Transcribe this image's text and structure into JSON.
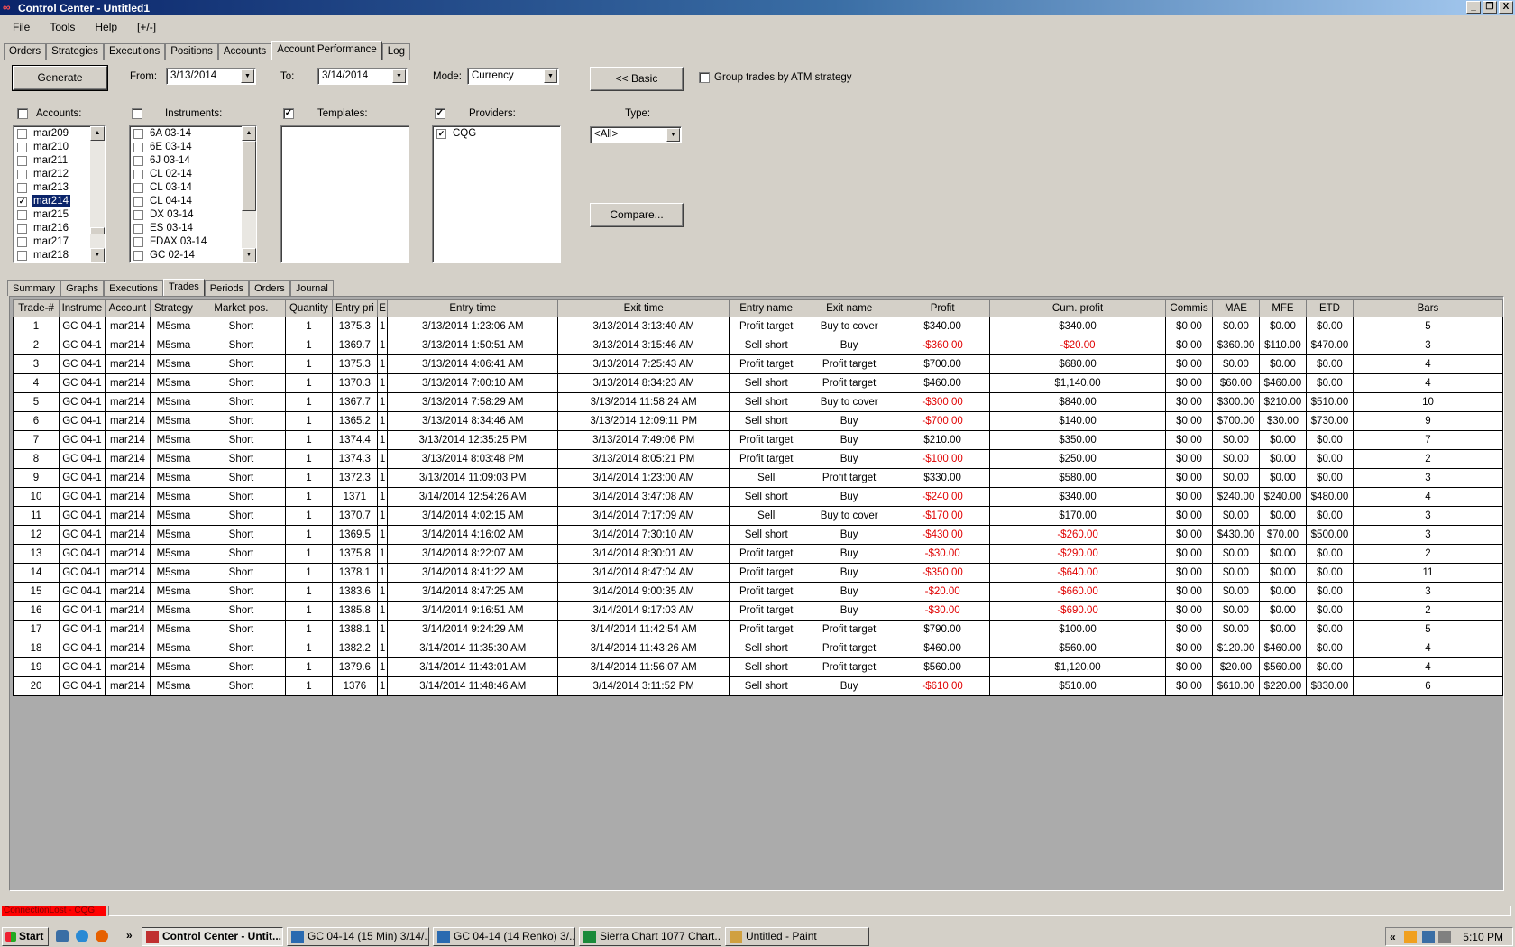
{
  "window": {
    "title": "Control Center - Untitled1",
    "buttons": [
      "_",
      "❒",
      "X"
    ]
  },
  "menu": [
    "File",
    "Tools",
    "Help",
    "[+/-]"
  ],
  "top_tabs": [
    {
      "label": "Orders",
      "active": false
    },
    {
      "label": "Strategies",
      "active": false
    },
    {
      "label": "Executions",
      "active": false
    },
    {
      "label": "Positions",
      "active": false
    },
    {
      "label": "Accounts",
      "active": false
    },
    {
      "label": "Account Performance",
      "active": true
    },
    {
      "label": "Log",
      "active": false
    }
  ],
  "controls": {
    "generate": "Generate",
    "from_label": "From:",
    "from_value": "3/13/2014",
    "to_label": "To:",
    "to_value": "3/14/2014",
    "mode_label": "Mode:",
    "mode_value": "Currency",
    "basic": "<< Basic",
    "group_label": "Group trades by ATM strategy",
    "group_checked": false,
    "type_label": "Type:",
    "type_value": "<All>",
    "compare": "Compare..."
  },
  "accounts": {
    "label": "Accounts:",
    "checked": false,
    "items": [
      {
        "name": "mar209",
        "checked": false,
        "selected": false
      },
      {
        "name": "mar210",
        "checked": false,
        "selected": false
      },
      {
        "name": "mar211",
        "checked": false,
        "selected": false
      },
      {
        "name": "mar212",
        "checked": false,
        "selected": false
      },
      {
        "name": "mar213",
        "checked": false,
        "selected": false
      },
      {
        "name": "mar214",
        "checked": true,
        "selected": true
      },
      {
        "name": "mar215",
        "checked": false,
        "selected": false
      },
      {
        "name": "mar216",
        "checked": false,
        "selected": false
      },
      {
        "name": "mar217",
        "checked": false,
        "selected": false
      },
      {
        "name": "mar218",
        "checked": false,
        "selected": false
      }
    ]
  },
  "instruments": {
    "label": "Instruments:",
    "checked": false,
    "items": [
      {
        "name": "6A 03-14",
        "checked": false
      },
      {
        "name": "6E 03-14",
        "checked": false
      },
      {
        "name": "6J 03-14",
        "checked": false
      },
      {
        "name": "CL 02-14",
        "checked": false
      },
      {
        "name": "CL 03-14",
        "checked": false
      },
      {
        "name": "CL 04-14",
        "checked": false
      },
      {
        "name": "DX 03-14",
        "checked": false
      },
      {
        "name": "ES 03-14",
        "checked": false
      },
      {
        "name": "FDAX 03-14",
        "checked": false
      },
      {
        "name": "GC 02-14",
        "checked": false
      }
    ]
  },
  "templates": {
    "label": "Templates:",
    "checked": true,
    "items": []
  },
  "providers": {
    "label": "Providers:",
    "checked": true,
    "items": [
      {
        "name": "CQG",
        "checked": true
      }
    ]
  },
  "sub_tabs": [
    {
      "label": "Summary",
      "active": false
    },
    {
      "label": "Graphs",
      "active": false
    },
    {
      "label": "Executions",
      "active": false
    },
    {
      "label": "Trades",
      "active": true
    },
    {
      "label": "Periods",
      "active": false
    },
    {
      "label": "Orders",
      "active": false
    },
    {
      "label": "Journal",
      "active": false
    }
  ],
  "trades": {
    "columns": [
      "Trade-#",
      "Instrume",
      "Account",
      "Strategy",
      "Market pos.",
      "Quantity",
      "Entry pri",
      "E",
      "Entry time",
      "Exit time",
      "Entry name",
      "Exit name",
      "Profit",
      "Cum. profit",
      "Commis",
      "MAE",
      "MFE",
      "ETD",
      "Bars"
    ],
    "negative_color": "#e00000",
    "rows": [
      [
        "1",
        "GC 04-1",
        "mar214",
        "M5sma",
        "Short",
        "1",
        "1375.3",
        "1",
        "3/13/2014 1:23:06 AM",
        "3/13/2014 3:13:40 AM",
        "Profit target",
        "Buy to cover",
        "$340.00",
        "$340.00",
        "$0.00",
        "$0.00",
        "$0.00",
        "$0.00",
        "5"
      ],
      [
        "2",
        "GC 04-1",
        "mar214",
        "M5sma",
        "Short",
        "1",
        "1369.7",
        "1",
        "3/13/2014 1:50:51 AM",
        "3/13/2014 3:15:46 AM",
        "Sell short",
        "Buy",
        "-$360.00",
        "-$20.00",
        "$0.00",
        "$360.00",
        "$110.00",
        "$470.00",
        "3"
      ],
      [
        "3",
        "GC 04-1",
        "mar214",
        "M5sma",
        "Short",
        "1",
        "1375.3",
        "1",
        "3/13/2014 4:06:41 AM",
        "3/13/2014 7:25:43 AM",
        "Profit target",
        "Profit target",
        "$700.00",
        "$680.00",
        "$0.00",
        "$0.00",
        "$0.00",
        "$0.00",
        "4"
      ],
      [
        "4",
        "GC 04-1",
        "mar214",
        "M5sma",
        "Short",
        "1",
        "1370.3",
        "1",
        "3/13/2014 7:00:10 AM",
        "3/13/2014 8:34:23 AM",
        "Sell short",
        "Profit target",
        "$460.00",
        "$1,140.00",
        "$0.00",
        "$60.00",
        "$460.00",
        "$0.00",
        "4"
      ],
      [
        "5",
        "GC 04-1",
        "mar214",
        "M5sma",
        "Short",
        "1",
        "1367.7",
        "1",
        "3/13/2014 7:58:29 AM",
        "3/13/2014 11:58:24 AM",
        "Sell short",
        "Buy to cover",
        "-$300.00",
        "$840.00",
        "$0.00",
        "$300.00",
        "$210.00",
        "$510.00",
        "10"
      ],
      [
        "6",
        "GC 04-1",
        "mar214",
        "M5sma",
        "Short",
        "1",
        "1365.2",
        "1",
        "3/13/2014 8:34:46 AM",
        "3/13/2014 12:09:11 PM",
        "Sell short",
        "Buy",
        "-$700.00",
        "$140.00",
        "$0.00",
        "$700.00",
        "$30.00",
        "$730.00",
        "9"
      ],
      [
        "7",
        "GC 04-1",
        "mar214",
        "M5sma",
        "Short",
        "1",
        "1374.4",
        "1",
        "3/13/2014 12:35:25 PM",
        "3/13/2014 7:49:06 PM",
        "Profit target",
        "Buy",
        "$210.00",
        "$350.00",
        "$0.00",
        "$0.00",
        "$0.00",
        "$0.00",
        "7"
      ],
      [
        "8",
        "GC 04-1",
        "mar214",
        "M5sma",
        "Short",
        "1",
        "1374.3",
        "1",
        "3/13/2014 8:03:48 PM",
        "3/13/2014 8:05:21 PM",
        "Profit target",
        "Buy",
        "-$100.00",
        "$250.00",
        "$0.00",
        "$0.00",
        "$0.00",
        "$0.00",
        "2"
      ],
      [
        "9",
        "GC 04-1",
        "mar214",
        "M5sma",
        "Short",
        "1",
        "1372.3",
        "1",
        "3/13/2014 11:09:03 PM",
        "3/14/2014 1:23:00 AM",
        "Sell",
        "Profit target",
        "$330.00",
        "$580.00",
        "$0.00",
        "$0.00",
        "$0.00",
        "$0.00",
        "3"
      ],
      [
        "10",
        "GC 04-1",
        "mar214",
        "M5sma",
        "Short",
        "1",
        "1371",
        "1",
        "3/14/2014 12:54:26 AM",
        "3/14/2014 3:47:08 AM",
        "Sell short",
        "Buy",
        "-$240.00",
        "$340.00",
        "$0.00",
        "$240.00",
        "$240.00",
        "$480.00",
        "4"
      ],
      [
        "11",
        "GC 04-1",
        "mar214",
        "M5sma",
        "Short",
        "1",
        "1370.7",
        "1",
        "3/14/2014 4:02:15 AM",
        "3/14/2014 7:17:09 AM",
        "Sell",
        "Buy to cover",
        "-$170.00",
        "$170.00",
        "$0.00",
        "$0.00",
        "$0.00",
        "$0.00",
        "3"
      ],
      [
        "12",
        "GC 04-1",
        "mar214",
        "M5sma",
        "Short",
        "1",
        "1369.5",
        "1",
        "3/14/2014 4:16:02 AM",
        "3/14/2014 7:30:10 AM",
        "Sell short",
        "Buy",
        "-$430.00",
        "-$260.00",
        "$0.00",
        "$430.00",
        "$70.00",
        "$500.00",
        "3"
      ],
      [
        "13",
        "GC 04-1",
        "mar214",
        "M5sma",
        "Short",
        "1",
        "1375.8",
        "1",
        "3/14/2014 8:22:07 AM",
        "3/14/2014 8:30:01 AM",
        "Profit target",
        "Buy",
        "-$30.00",
        "-$290.00",
        "$0.00",
        "$0.00",
        "$0.00",
        "$0.00",
        "2"
      ],
      [
        "14",
        "GC 04-1",
        "mar214",
        "M5sma",
        "Short",
        "1",
        "1378.1",
        "1",
        "3/14/2014 8:41:22 AM",
        "3/14/2014 8:47:04 AM",
        "Profit target",
        "Buy",
        "-$350.00",
        "-$640.00",
        "$0.00",
        "$0.00",
        "$0.00",
        "$0.00",
        "11"
      ],
      [
        "15",
        "GC 04-1",
        "mar214",
        "M5sma",
        "Short",
        "1",
        "1383.6",
        "1",
        "3/14/2014 8:47:25 AM",
        "3/14/2014 9:00:35 AM",
        "Profit target",
        "Buy",
        "-$20.00",
        "-$660.00",
        "$0.00",
        "$0.00",
        "$0.00",
        "$0.00",
        "3"
      ],
      [
        "16",
        "GC 04-1",
        "mar214",
        "M5sma",
        "Short",
        "1",
        "1385.8",
        "1",
        "3/14/2014 9:16:51 AM",
        "3/14/2014 9:17:03 AM",
        "Profit target",
        "Buy",
        "-$30.00",
        "-$690.00",
        "$0.00",
        "$0.00",
        "$0.00",
        "$0.00",
        "2"
      ],
      [
        "17",
        "GC 04-1",
        "mar214",
        "M5sma",
        "Short",
        "1",
        "1388.1",
        "1",
        "3/14/2014 9:24:29 AM",
        "3/14/2014 11:42:54 AM",
        "Profit target",
        "Profit target",
        "$790.00",
        "$100.00",
        "$0.00",
        "$0.00",
        "$0.00",
        "$0.00",
        "5"
      ],
      [
        "18",
        "GC 04-1",
        "mar214",
        "M5sma",
        "Short",
        "1",
        "1382.2",
        "1",
        "3/14/2014 11:35:30 AM",
        "3/14/2014 11:43:26 AM",
        "Sell short",
        "Profit target",
        "$460.00",
        "$560.00",
        "$0.00",
        "$120.00",
        "$460.00",
        "$0.00",
        "4"
      ],
      [
        "19",
        "GC 04-1",
        "mar214",
        "M5sma",
        "Short",
        "1",
        "1379.6",
        "1",
        "3/14/2014 11:43:01 AM",
        "3/14/2014 11:56:07 AM",
        "Sell short",
        "Profit target",
        "$560.00",
        "$1,120.00",
        "$0.00",
        "$20.00",
        "$560.00",
        "$0.00",
        "4"
      ],
      [
        "20",
        "GC 04-1",
        "mar214",
        "M5sma",
        "Short",
        "1",
        "1376",
        "1",
        "3/14/2014 11:48:46 AM",
        "3/14/2014 3:11:52 PM",
        "Sell short",
        "Buy",
        "-$610.00",
        "$510.00",
        "$0.00",
        "$610.00",
        "$220.00",
        "$830.00",
        "6"
      ]
    ]
  },
  "status": {
    "text": "ConnectionLost - CQG",
    "color": "#ff0000"
  },
  "taskbar": {
    "start": "Start",
    "quicklaunch": [
      "desktop-icon",
      "ie-icon",
      "firefox-icon"
    ],
    "chevron": "»",
    "tasks": [
      {
        "label": "Control Center - Untit...",
        "active": true,
        "icon": "ninjatrader-icon"
      },
      {
        "label": "GC 04-14 (15 Min)  3/14/...",
        "active": false,
        "icon": "chart-icon"
      },
      {
        "label": "GC 04-14 (14 Renko)  3/...",
        "active": false,
        "icon": "chart-icon"
      },
      {
        "label": "Sierra Chart 1077 Chart...",
        "active": false,
        "icon": "globe-icon"
      },
      {
        "label": "Untitled - Paint",
        "active": false,
        "icon": "paint-icon"
      }
    ],
    "tray_collapse": "«",
    "clock": "5:10 PM"
  }
}
